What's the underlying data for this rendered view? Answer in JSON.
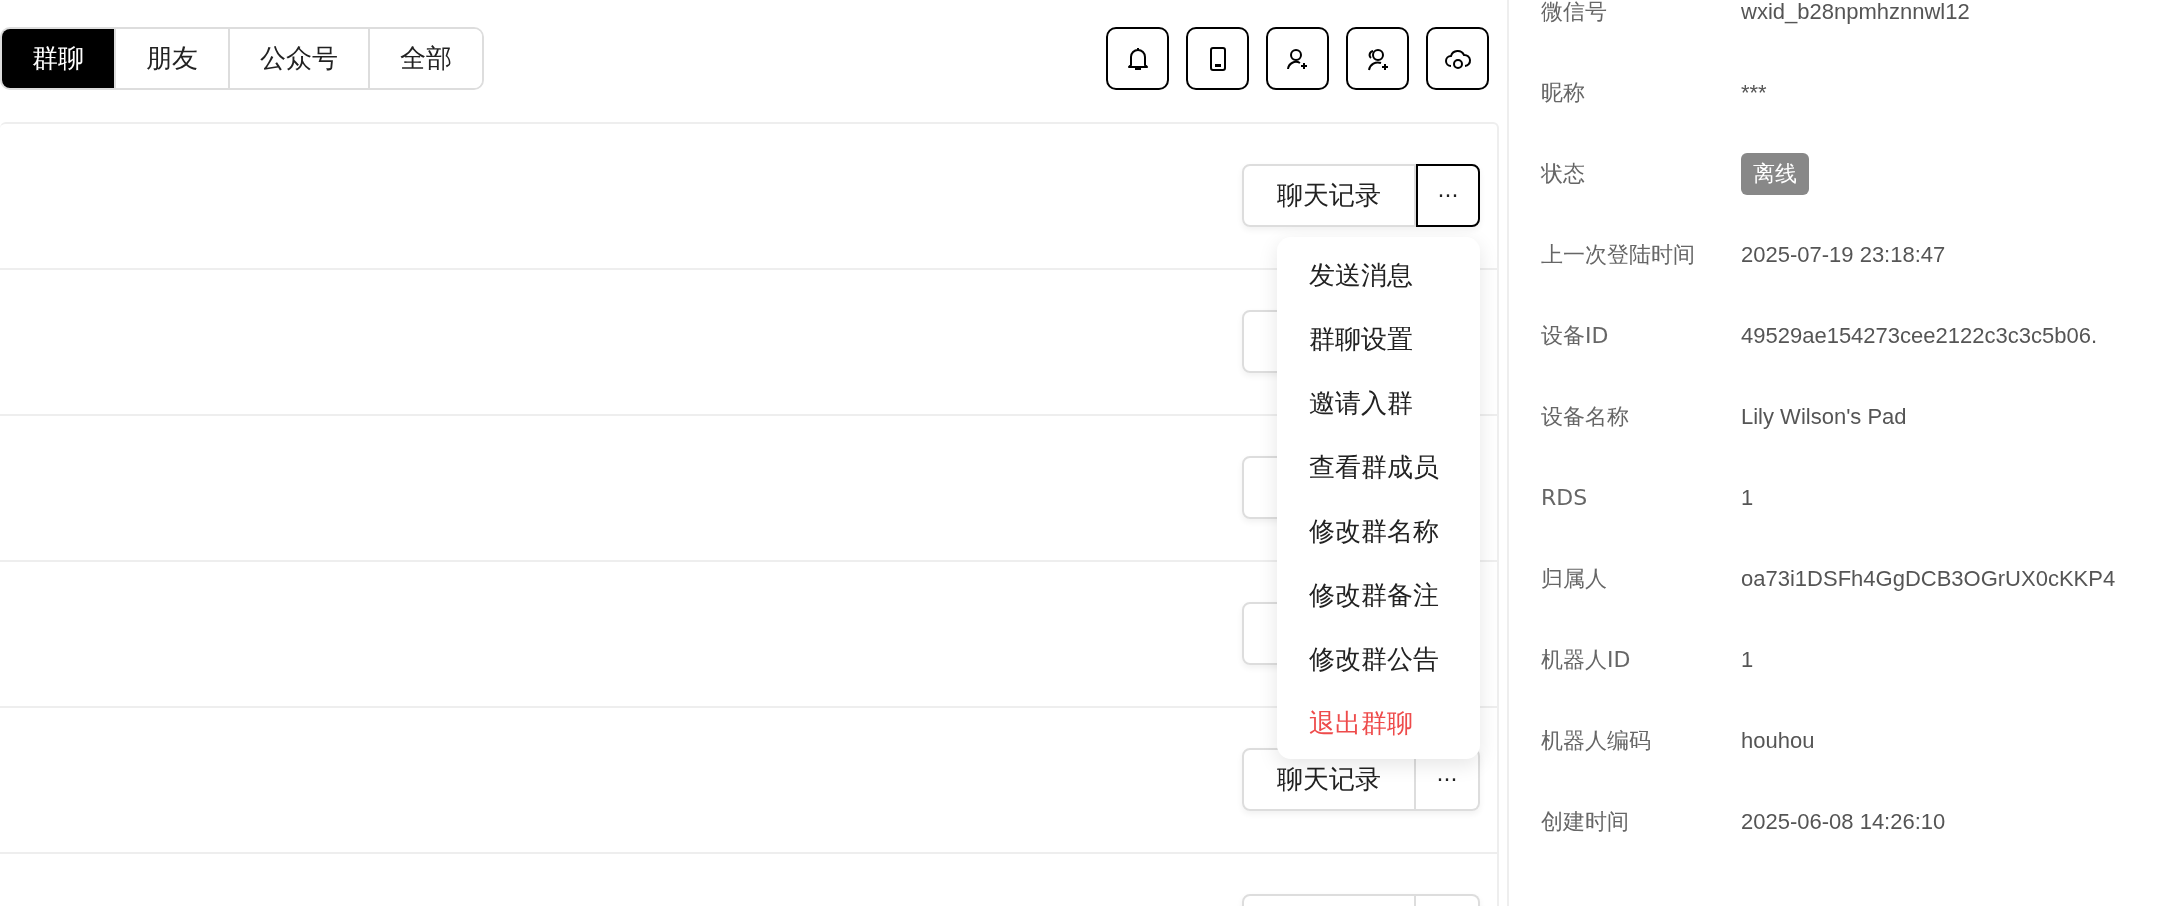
{
  "tabs": [
    {
      "label": "群聊",
      "selected": true
    },
    {
      "label": "朋友",
      "selected": false
    },
    {
      "label": "公众号",
      "selected": false
    },
    {
      "label": "全部",
      "selected": false
    }
  ],
  "toolbar": [
    {
      "kind": "bell"
    },
    {
      "kind": "phone"
    },
    {
      "kind": "user-add"
    },
    {
      "kind": "users-add"
    },
    {
      "kind": "cloud"
    }
  ],
  "rows": [
    {
      "kind": "full",
      "chat_button": "聊天记录",
      "more": "···",
      "more_active": true
    },
    {
      "kind": "covered"
    },
    {
      "kind": "covered"
    },
    {
      "kind": "covered"
    },
    {
      "kind": "full",
      "chat_button": "聊天记录",
      "more": "···",
      "more_active": false
    },
    {
      "kind": "clipped"
    }
  ],
  "menu": {
    "items": [
      {
        "label": "发送消息",
        "kind": "normal"
      },
      {
        "label": "群聊设置",
        "kind": "normal"
      },
      {
        "label": "邀请入群",
        "kind": "normal"
      },
      {
        "label": "查看群成员",
        "kind": "normal"
      },
      {
        "label": "修改群名称",
        "kind": "normal"
      },
      {
        "label": "修改群备注",
        "kind": "normal"
      },
      {
        "label": "修改群公告",
        "kind": "normal"
      },
      {
        "label": "退出群聊",
        "kind": "danger"
      }
    ]
  },
  "details": [
    {
      "label": "微信号",
      "value": "wxid_b28npmhznnwl12",
      "kind": "text"
    },
    {
      "label": "昵称",
      "value": "***",
      "kind": "text"
    },
    {
      "label": "状态",
      "value": "离线",
      "kind": "tag"
    },
    {
      "label": "上一次登陆时间",
      "value": "2025-07-19 23:18:47",
      "kind": "text"
    },
    {
      "label": "设备ID",
      "value": "49529ae154273cee2122c3c3c5b06.",
      "kind": "text"
    },
    {
      "label": "设备名称",
      "value": "Lily Wilson's Pad",
      "kind": "text"
    },
    {
      "label": "RDS",
      "value": "1",
      "kind": "text"
    },
    {
      "label": "归属人",
      "value": "oa73i1DSFh4GgDCB3OGrUX0cKKP4",
      "kind": "text"
    },
    {
      "label": "机器人ID",
      "value": "1",
      "kind": "text"
    },
    {
      "label": "机器人编码",
      "value": "houhou",
      "kind": "text"
    },
    {
      "label": "创建时间",
      "value": "2025-06-08 14:26:10",
      "kind": "text"
    }
  ]
}
